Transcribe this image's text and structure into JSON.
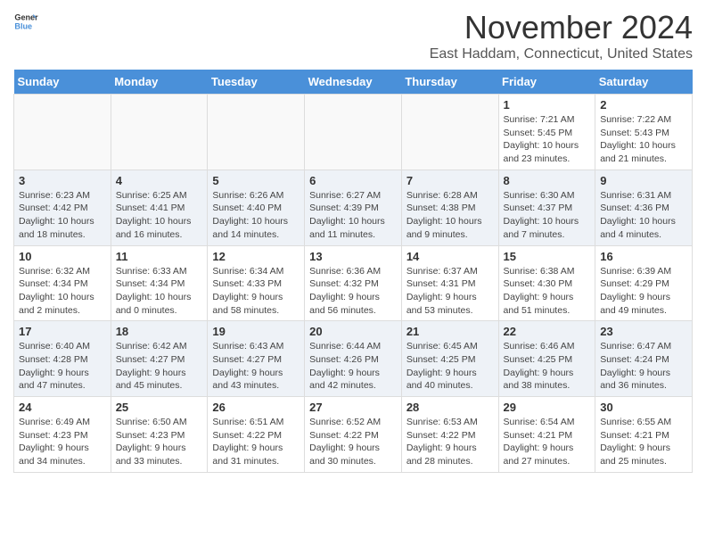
{
  "header": {
    "logo_line1": "General",
    "logo_line2": "Blue",
    "month": "November 2024",
    "location": "East Haddam, Connecticut, United States"
  },
  "weekdays": [
    "Sunday",
    "Monday",
    "Tuesday",
    "Wednesday",
    "Thursday",
    "Friday",
    "Saturday"
  ],
  "weeks": [
    [
      {
        "day": "",
        "info": ""
      },
      {
        "day": "",
        "info": ""
      },
      {
        "day": "",
        "info": ""
      },
      {
        "day": "",
        "info": ""
      },
      {
        "day": "",
        "info": ""
      },
      {
        "day": "1",
        "info": "Sunrise: 7:21 AM\nSunset: 5:45 PM\nDaylight: 10 hours and 23 minutes."
      },
      {
        "day": "2",
        "info": "Sunrise: 7:22 AM\nSunset: 5:43 PM\nDaylight: 10 hours and 21 minutes."
      }
    ],
    [
      {
        "day": "3",
        "info": "Sunrise: 6:23 AM\nSunset: 4:42 PM\nDaylight: 10 hours and 18 minutes."
      },
      {
        "day": "4",
        "info": "Sunrise: 6:25 AM\nSunset: 4:41 PM\nDaylight: 10 hours and 16 minutes."
      },
      {
        "day": "5",
        "info": "Sunrise: 6:26 AM\nSunset: 4:40 PM\nDaylight: 10 hours and 14 minutes."
      },
      {
        "day": "6",
        "info": "Sunrise: 6:27 AM\nSunset: 4:39 PM\nDaylight: 10 hours and 11 minutes."
      },
      {
        "day": "7",
        "info": "Sunrise: 6:28 AM\nSunset: 4:38 PM\nDaylight: 10 hours and 9 minutes."
      },
      {
        "day": "8",
        "info": "Sunrise: 6:30 AM\nSunset: 4:37 PM\nDaylight: 10 hours and 7 minutes."
      },
      {
        "day": "9",
        "info": "Sunrise: 6:31 AM\nSunset: 4:36 PM\nDaylight: 10 hours and 4 minutes."
      }
    ],
    [
      {
        "day": "10",
        "info": "Sunrise: 6:32 AM\nSunset: 4:34 PM\nDaylight: 10 hours and 2 minutes."
      },
      {
        "day": "11",
        "info": "Sunrise: 6:33 AM\nSunset: 4:34 PM\nDaylight: 10 hours and 0 minutes."
      },
      {
        "day": "12",
        "info": "Sunrise: 6:34 AM\nSunset: 4:33 PM\nDaylight: 9 hours and 58 minutes."
      },
      {
        "day": "13",
        "info": "Sunrise: 6:36 AM\nSunset: 4:32 PM\nDaylight: 9 hours and 56 minutes."
      },
      {
        "day": "14",
        "info": "Sunrise: 6:37 AM\nSunset: 4:31 PM\nDaylight: 9 hours and 53 minutes."
      },
      {
        "day": "15",
        "info": "Sunrise: 6:38 AM\nSunset: 4:30 PM\nDaylight: 9 hours and 51 minutes."
      },
      {
        "day": "16",
        "info": "Sunrise: 6:39 AM\nSunset: 4:29 PM\nDaylight: 9 hours and 49 minutes."
      }
    ],
    [
      {
        "day": "17",
        "info": "Sunrise: 6:40 AM\nSunset: 4:28 PM\nDaylight: 9 hours and 47 minutes."
      },
      {
        "day": "18",
        "info": "Sunrise: 6:42 AM\nSunset: 4:27 PM\nDaylight: 9 hours and 45 minutes."
      },
      {
        "day": "19",
        "info": "Sunrise: 6:43 AM\nSunset: 4:27 PM\nDaylight: 9 hours and 43 minutes."
      },
      {
        "day": "20",
        "info": "Sunrise: 6:44 AM\nSunset: 4:26 PM\nDaylight: 9 hours and 42 minutes."
      },
      {
        "day": "21",
        "info": "Sunrise: 6:45 AM\nSunset: 4:25 PM\nDaylight: 9 hours and 40 minutes."
      },
      {
        "day": "22",
        "info": "Sunrise: 6:46 AM\nSunset: 4:25 PM\nDaylight: 9 hours and 38 minutes."
      },
      {
        "day": "23",
        "info": "Sunrise: 6:47 AM\nSunset: 4:24 PM\nDaylight: 9 hours and 36 minutes."
      }
    ],
    [
      {
        "day": "24",
        "info": "Sunrise: 6:49 AM\nSunset: 4:23 PM\nDaylight: 9 hours and 34 minutes."
      },
      {
        "day": "25",
        "info": "Sunrise: 6:50 AM\nSunset: 4:23 PM\nDaylight: 9 hours and 33 minutes."
      },
      {
        "day": "26",
        "info": "Sunrise: 6:51 AM\nSunset: 4:22 PM\nDaylight: 9 hours and 31 minutes."
      },
      {
        "day": "27",
        "info": "Sunrise: 6:52 AM\nSunset: 4:22 PM\nDaylight: 9 hours and 30 minutes."
      },
      {
        "day": "28",
        "info": "Sunrise: 6:53 AM\nSunset: 4:22 PM\nDaylight: 9 hours and 28 minutes."
      },
      {
        "day": "29",
        "info": "Sunrise: 6:54 AM\nSunset: 4:21 PM\nDaylight: 9 hours and 27 minutes."
      },
      {
        "day": "30",
        "info": "Sunrise: 6:55 AM\nSunset: 4:21 PM\nDaylight: 9 hours and 25 minutes."
      }
    ]
  ]
}
